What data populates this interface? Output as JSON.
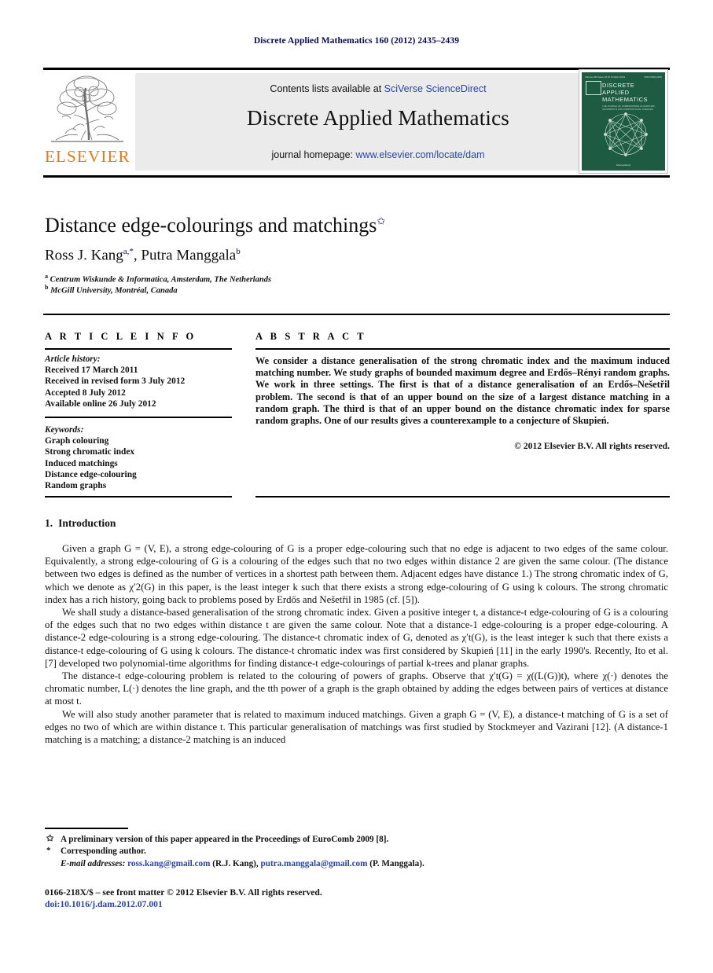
{
  "running_head": "Discrete Applied Mathematics 160 (2012) 2435–2439",
  "masthead": {
    "publisher_name": "ELSEVIER",
    "contents_prefix": "Contents lists available at ",
    "contents_link": "SciVerse ScienceDirect",
    "journal_title": "Discrete Applied Mathematics",
    "homepage_prefix": "journal homepage: ",
    "homepage_link": "www.elsevier.com/locate/dam",
    "cover": {
      "top_left": "Volume 160  Issue 10  15 October 2012",
      "top_right": "ISSN 0166-218X",
      "title": "DISCRETE APPLIED MATHEMATICS",
      "subtitle": "THE JOURNAL OF COMBINATORIAL ALGORITHMS, INFORMATICS AND COMPUTATIONAL SCIENCES",
      "footer": "ScienceDirect"
    }
  },
  "article": {
    "title": "Distance edge-colourings and matchings",
    "title_marker": "✩",
    "authors": "Ross J. Kang",
    "author1_marks": "a,*",
    "author2": "Putra Manggala",
    "author2_marks": "b",
    "affiliations": [
      {
        "mark": "a",
        "text": "Centrum Wiskunde & Informatica, Amsterdam, The Netherlands"
      },
      {
        "mark": "b",
        "text": "McGill University, Montréal, Canada"
      }
    ]
  },
  "info": {
    "header": "A R T I C L E   I N F O",
    "history_label": "Article history:",
    "history": [
      "Received 17 March 2011",
      "Received in revised form 3 July 2012",
      "Accepted 8 July 2012",
      "Available online 26 July 2012"
    ],
    "keywords_label": "Keywords:",
    "keywords": [
      "Graph colouring",
      "Strong chromatic index",
      "Induced matchings",
      "Distance edge-colouring",
      "Random graphs"
    ]
  },
  "abstract": {
    "header": "A B S T R A C T",
    "text": "We consider a distance generalisation of the strong chromatic index and the maximum induced matching number. We study graphs of bounded maximum degree and Erdős–Rényi random graphs. We work in three settings. The first is that of a distance generalisation of an Erdős–Nešetřil problem. The second is that of an upper bound on the size of a largest distance matching in a random graph. The third is that of an upper bound on the distance chromatic index for sparse random graphs. One of our results gives a counterexample to a conjecture of Skupień.",
    "copyright": "© 2012 Elsevier B.V. All rights reserved."
  },
  "section": {
    "number": "1.",
    "heading": "Introduction"
  },
  "paragraphs": [
    "Given a graph G = (V, E), a strong edge-colouring of G is a proper edge-colouring such that no edge is adjacent to two edges of the same colour. Equivalently, a strong edge-colouring of G is a colouring of the edges such that no two edges within distance 2 are given the same colour. (The distance between two edges is defined as the number of vertices in a shortest path between them. Adjacent edges have distance 1.) The strong chromatic index of G, which we denote as χ′2(G) in this paper, is the least integer k such that there exists a strong edge-colouring of G using k colours. The strong chromatic index has a rich history, going back to problems posed by Erdős and Nešetřil in 1985 (cf. [5]).",
    "We shall study a distance-based generalisation of the strong chromatic index. Given a positive integer t, a distance-t edge-colouring of G is a colouring of the edges such that no two edges within distance t are given the same colour. Note that a distance-1 edge-colouring is a proper edge-colouring. A distance-2 edge-colouring is a strong edge-colouring. The distance-t chromatic index of G, denoted as χ′t(G), is the least integer k such that there exists a distance-t edge-colouring of G using k colours. The distance-t chromatic index was first considered by Skupień [11] in the early 1990's. Recently, Ito et al. [7] developed two polynomial-time algorithms for finding distance-t edge-colourings of partial k-trees and planar graphs.",
    "The distance-t edge-colouring problem is related to the colouring of powers of graphs. Observe that χ′t(G) = χ((L(G))t), where χ(·) denotes the chromatic number, L(·) denotes the line graph, and the tth power of a graph is the graph obtained by adding the edges between pairs of vertices at distance at most t.",
    "We will also study another parameter that is related to maximum induced matchings. Given a graph G = (V, E), a distance-t matching of G is a set of edges no two of which are within distance t. This particular generalisation of matchings was first studied by Stockmeyer and Vazirani [12]. (A distance-1 matching is a matching; a distance-2 matching is an induced"
  ],
  "footnotes": {
    "star_mark": "✩",
    "star_text": "A preliminary version of this paper appeared in the Proceedings of EuroComb 2009 [8].",
    "corr_mark": "*",
    "corr_text": "Corresponding author.",
    "email_label": "E-mail addresses:",
    "email1": "ross.kang@gmail.com",
    "email1_who": "(R.J. Kang),",
    "email2": "putra.manggala@gmail.com",
    "email2_who": "(P. Manggala)."
  },
  "imprint": {
    "issn_line": "0166-218X/$ – see front matter © 2012 Elsevier B.V. All rights reserved.",
    "doi": "doi:10.1016/j.dam.2012.07.001"
  },
  "colors": {
    "link": "#2b45a0",
    "running_head": "#0a0a50",
    "elsevier_orange": "#e77817",
    "cover_green": "#1d5c43",
    "banner_bg": "#ebebeb"
  }
}
